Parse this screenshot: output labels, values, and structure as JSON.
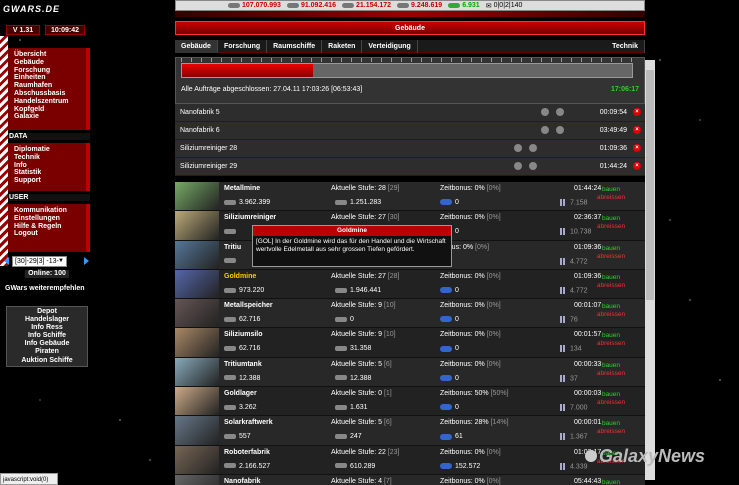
{
  "resources": [
    {
      "icon": "metal-icon",
      "value": "107.070.993"
    },
    {
      "icon": "crystal-icon",
      "value": "91.092.416"
    },
    {
      "icon": "tritium-icon",
      "value": "21.154.172"
    },
    {
      "icon": "gold-icon",
      "value": "9.248.619"
    },
    {
      "icon": "energy-icon",
      "value": "6.931"
    }
  ],
  "mail": "0|0|2|140",
  "logo": "GWARS.DE",
  "version": "V 1.31",
  "clock": "10:09:42",
  "menu1": [
    "Übersicht",
    "Gebäude",
    "Forschung",
    "Einheiten",
    "Raumhafen",
    "Abschussbasis",
    "Handelszentrum",
    "Kopfgeld",
    "Galaxie"
  ],
  "section_data": "DATA",
  "menu2": [
    "Diplomatie",
    "Technik",
    "Info",
    "Statistik",
    "Support"
  ],
  "section_user": "USER",
  "menu3": [
    "Kommunikation",
    "Einstellungen",
    "Hilfe & Regeln",
    "",
    "Logout"
  ],
  "planet_select": "[30]-29|3] -13-",
  "online": "Online: 100",
  "empfehlen": "GWars weiterempfehlen",
  "submenu": [
    "Depot",
    "Handelslager",
    "Info Ress",
    "Info Schiffe",
    "Info Gebäude",
    "Piraten",
    "Auktion Schiffe"
  ],
  "statusbar": "javascript:void(0)",
  "header": "Gebäude",
  "tabs": [
    "Gebäude",
    "Forschung",
    "Raumschiffe",
    "Raketen",
    "Verteidigung"
  ],
  "tab_right": "Technik",
  "progress_fraction": 0.29,
  "all_done": "Alle Aufträge abgeschlossen: 27.04.11 17:03:26 [06:53:43]",
  "all_time": "17:06:17",
  "queue": [
    {
      "name": "Nanofabrik 5",
      "time": "00:09:54"
    },
    {
      "name": "Nanofabrik 6",
      "time": "03:49:49"
    },
    {
      "name": "Siliziumreiniger 28",
      "time": "01:09:36"
    },
    {
      "name": "Siliziumreiniger 29",
      "time": "01:44:24"
    }
  ],
  "buildings": [
    {
      "name": "Metallmine",
      "stufe": "Aktuelle Stufe: 28",
      "stufe_b": "[29]",
      "zeit": "Zeitbonus: 0%",
      "zeit_b": "[0%]",
      "time": "01:44:24",
      "r1": "3.962.399",
      "r2": "1.251.283",
      "r3": "0",
      "r4": "7.158",
      "color": "#7a6"
    },
    {
      "name": "Siliziumreiniger",
      "stufe": "Aktuelle Stufe: 27",
      "stufe_b": "[30]",
      "zeit": "Zeitbonus: 0%",
      "zeit_b": "[0%]",
      "time": "02:36:37",
      "r1": "",
      "r2": "",
      "r3": "0",
      "r4": "10.738",
      "color": "#ba7"
    },
    {
      "name": "Tritiu",
      "stufe": "",
      "stufe_b": "",
      "zeit": "bonus: 0%",
      "zeit_b": "[0%]",
      "time": "01:09:36",
      "r1": "",
      "r2": "",
      "r3": "",
      "r4": "4.772",
      "color": "#579"
    },
    {
      "name": "Goldmine",
      "stufe": "Aktuelle Stufe: 27",
      "stufe_b": "[28]",
      "zeit": "Zeitbonus: 0%",
      "zeit_b": "[0%]",
      "time": "01:09:36",
      "r1": "973.220",
      "r2": "1.946.441",
      "r3": "0",
      "r4": "4.772",
      "color": "#56a",
      "gold": true
    },
    {
      "name": "Metallspeicher",
      "stufe": "Aktuelle Stufe: 9",
      "stufe_b": "[10]",
      "zeit": "Zeitbonus: 0%",
      "zeit_b": "[0%]",
      "time": "00:01:07",
      "r1": "62.716",
      "r2": "0",
      "r3": "0",
      "r4": "76",
      "color": "#655"
    },
    {
      "name": "Siliziumsilo",
      "stufe": "Aktuelle Stufe: 9",
      "stufe_b": "[10]",
      "zeit": "Zeitbonus: 0%",
      "zeit_b": "[0%]",
      "time": "00:01:57",
      "r1": "62.716",
      "r2": "31.358",
      "r3": "0",
      "r4": "134",
      "color": "#a86"
    },
    {
      "name": "Tritiumtank",
      "stufe": "Aktuelle Stufe: 5",
      "stufe_b": "[6]",
      "zeit": "Zeitbonus: 0%",
      "zeit_b": "[0%]",
      "time": "00:00:33",
      "r1": "12.388",
      "r2": "12.388",
      "r3": "0",
      "r4": "37",
      "color": "#8ab"
    },
    {
      "name": "Goldlager",
      "stufe": "Aktuelle Stufe: 0",
      "stufe_b": "[1]",
      "zeit": "Zeitbonus: 50%",
      "zeit_b": "[50%]",
      "time": "00:00:03",
      "r1": "3.262",
      "r2": "1.631",
      "r3": "0",
      "r4": "7.000",
      "color": "#ca8"
    },
    {
      "name": "Solarkraftwerk",
      "stufe": "Aktuelle Stufe: 5",
      "stufe_b": "[6]",
      "zeit": "Zeitbonus: 28%",
      "zeit_b": "[14%]",
      "time": "00:00:01",
      "r1": "557",
      "r2": "247",
      "r3": "61",
      "r4": "1.367",
      "color": "#678"
    },
    {
      "name": "Roboterfabrik",
      "stufe": "Aktuelle Stufe: 22",
      "stufe_b": "[23]",
      "zeit": "Zeitbonus: 0%",
      "zeit_b": "[0%]",
      "time": "01:03:17",
      "r1": "2.166.527",
      "r2": "610.289",
      "r3": "152.572",
      "r4": "4.339",
      "color": "#765"
    },
    {
      "name": "Nanofabrik",
      "stufe": "Aktuelle Stufe: 4",
      "stufe_b": "[7]",
      "zeit": "Zeitbonus: 0%",
      "zeit_b": "[0%]",
      "time": "05:44:43",
      "r1": "",
      "r2": "",
      "r3": "",
      "r4": "",
      "color": "#666"
    }
  ],
  "bauen": "bauen",
  "abreissen": "abreissen",
  "tooltip": {
    "title": "Goldmine",
    "body": "[GOL] In der Goldmine wird das für den Handel und die Wirtschaft wertvolle Edelmetall aus sehr grossen Tiefen gefördert."
  },
  "watermark": "GalaxyNews"
}
